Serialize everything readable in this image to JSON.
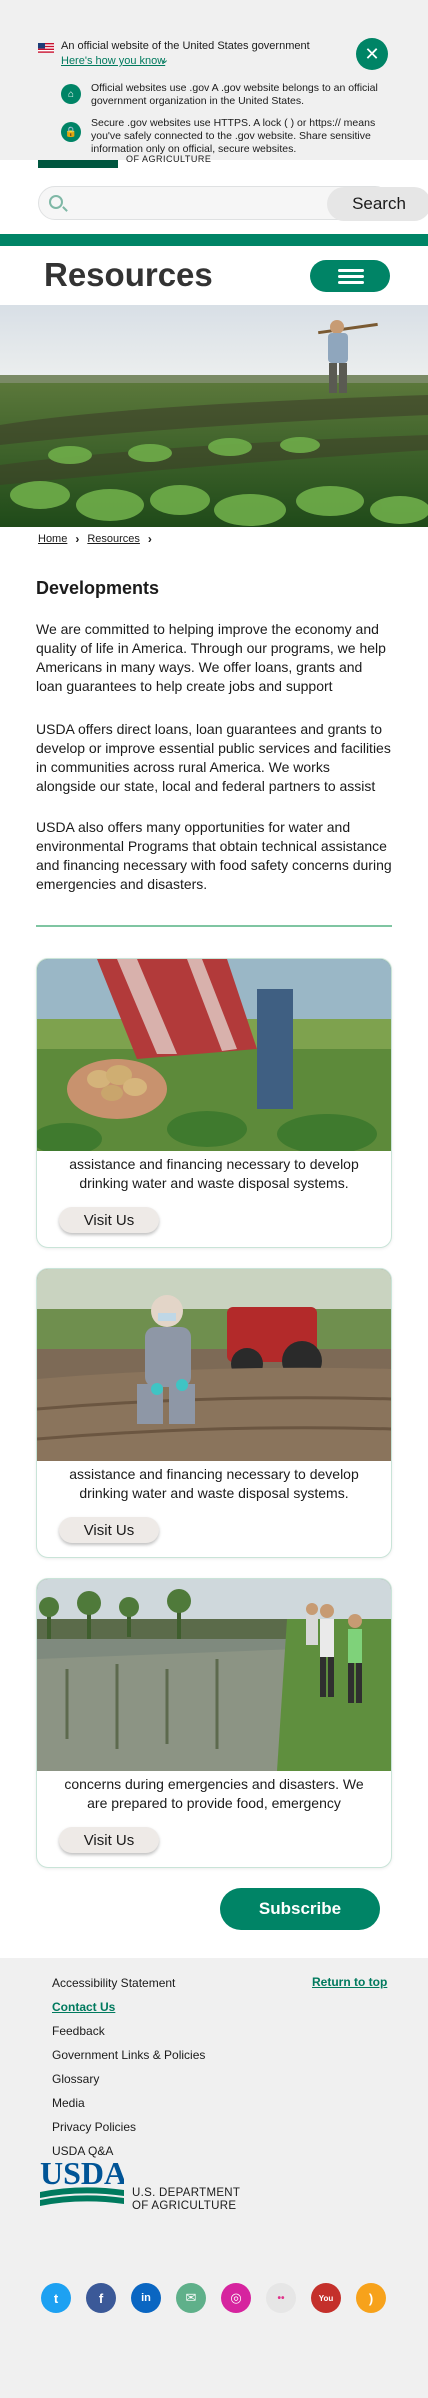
{
  "gov_banner": {
    "official_text": "An official website of the United States government",
    "how_link": "Here's how you know",
    "dotgov_text": "Official websites use .gov A .gov website belongs to an official government organization in the United States.",
    "https_text": "Secure .gov websites use HTTPS. A lock ( ) or https:// means you've safely connected to the .gov website. Share sensitive information only on official, secure websites."
  },
  "header": {
    "agency_fragment": "OF AGRICULTURE",
    "search_placeholder": "",
    "search_label": "Search",
    "page_title": "Resources"
  },
  "breadcrumb": [
    "Home",
    "Resources"
  ],
  "main": {
    "section_title": "Developments",
    "paragraphs": [
      "We are committed to helping improve the economy and quality of life in America. Through our programs, we help Americans in many ways. We offer loans, grants and loan guarantees to help create jobs and support",
      "USDA offers direct loans, loan guarantees and grants to develop or improve essential public services and facilities in communities across rural America. We works alongside our state, local and federal partners to assist",
      "USDA also offers many opportunities for water and environmental Programs that obtain technical assistance and financing necessary with food safety concerns during emergencies and disasters."
    ],
    "cards": [
      {
        "text": "assistance and financing necessary to develop drinking water and waste disposal systems.",
        "button": "Visit Us"
      },
      {
        "text": "assistance and financing necessary to develop drinking water and waste disposal systems.",
        "button": "Visit Us"
      },
      {
        "text": "concerns during emergencies and disasters. We are prepared to provide food, emergency",
        "button": "Visit Us"
      }
    ],
    "subscribe_label": "Subscribe"
  },
  "footer": {
    "return_to_top": "Return to top",
    "links": [
      "Accessibility Statement",
      "Contact Us",
      "Feedback",
      "Government Links & Policies",
      "Glossary",
      "Media",
      "Privacy Policies",
      "USDA Q&A"
    ],
    "agency_name_line1": "U.S. DEPARTMENT",
    "agency_name_line2": "OF AGRICULTURE",
    "logo_text": "USDA",
    "social": [
      {
        "icon": "twitter-icon",
        "color": "#1da1f2",
        "glyph": "t"
      },
      {
        "icon": "facebook-icon",
        "color": "#3b5998",
        "glyph": "f"
      },
      {
        "icon": "linkedin-icon",
        "color": "#0a66c2",
        "glyph": "in"
      },
      {
        "icon": "email-icon",
        "color": "#5fb08a",
        "glyph": "✉"
      },
      {
        "icon": "instagram-icon",
        "color": "#d6249f",
        "glyph": "◎"
      },
      {
        "icon": "flickr-icon",
        "color": "#e8e8e8",
        "glyph": "••"
      },
      {
        "icon": "youtube-icon",
        "color": "#c4302b",
        "glyph": "You"
      },
      {
        "icon": "rss-icon",
        "color": "#f7a21b",
        "glyph": ")"
      }
    ]
  },
  "colors": {
    "brand": "#008466",
    "accent_link": "#007a5e"
  }
}
